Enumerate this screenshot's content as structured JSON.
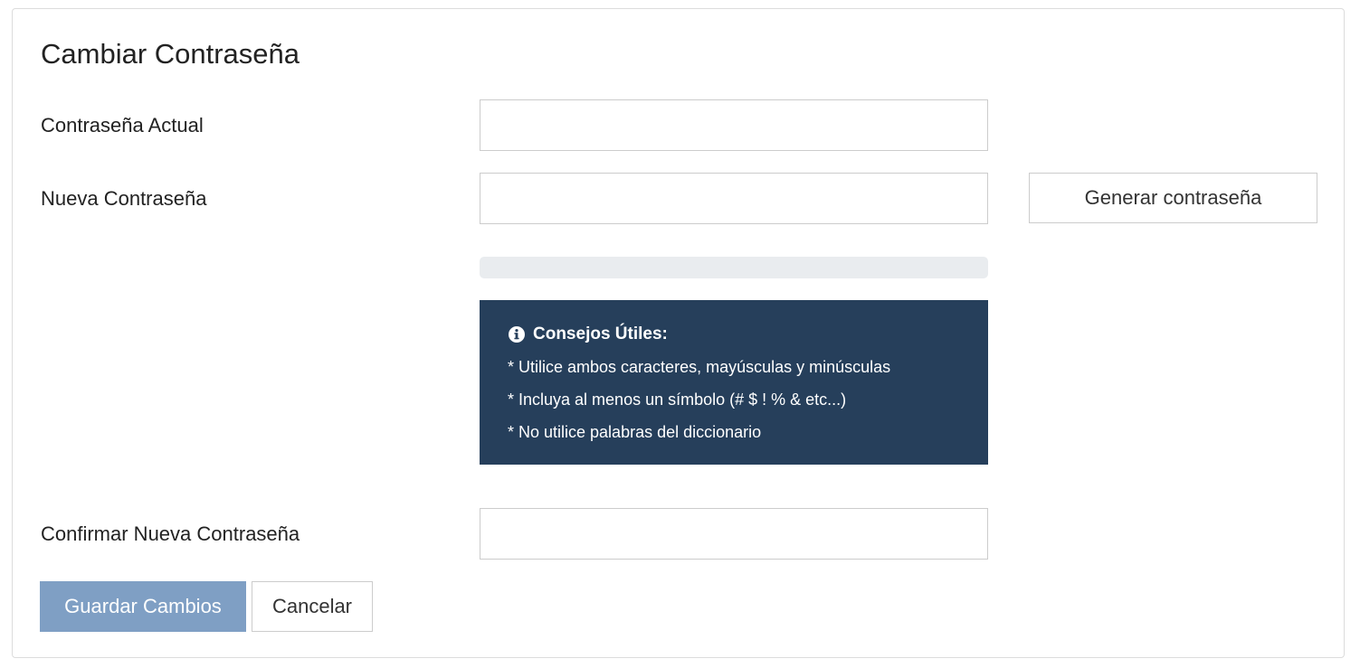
{
  "form": {
    "title": "Cambiar Contraseña",
    "current_password": {
      "label": "Contraseña Actual",
      "value": "",
      "placeholder": ""
    },
    "new_password": {
      "label": "Nueva Contraseña",
      "value": "",
      "placeholder": ""
    },
    "generate_button_label": "Generar contraseña",
    "strength": {
      "level": 0
    },
    "tips": {
      "heading": "Consejos Útiles:",
      "icon": "info-circle-icon",
      "items": [
        "* Utilice ambos caracteres, mayúsculas y minúsculas",
        "* Incluya al menos un símbolo (# $ ! % & etc...)",
        "* No utilice palabras del diccionario"
      ]
    },
    "confirm_password": {
      "label": "Confirmar Nueva Contraseña",
      "value": "",
      "placeholder": ""
    },
    "save_button_label": "Guardar Cambios",
    "cancel_button_label": "Cancelar"
  },
  "colors": {
    "tips_background": "#263f5b",
    "save_button": "#7f9fc4",
    "strength_track": "#e9ecef",
    "card_border": "#dcdcdc"
  }
}
